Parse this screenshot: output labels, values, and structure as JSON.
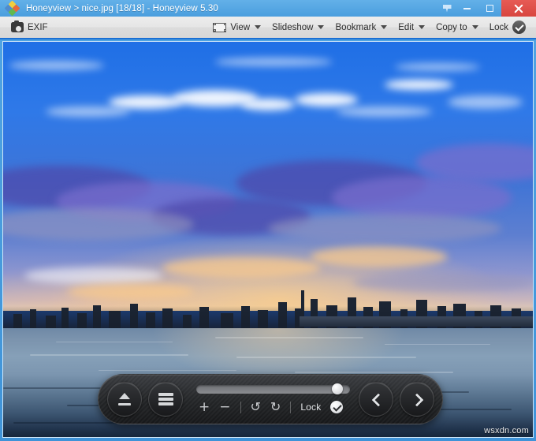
{
  "window": {
    "title": "Honeyview > nice.jpg [18/18] - Honeyview 5.30",
    "app_icon": "honeyview-diamond-icon",
    "controls": {
      "pin_label": "pin-icon",
      "minimize_label": "minimize-icon",
      "maximize_label": "maximize-icon",
      "close_label": "close-icon"
    },
    "accent_blue": "#1a6fd4",
    "titlebar_blue": "#4a9ede",
    "close_red": "#d8463f"
  },
  "toolbar": {
    "items": [
      {
        "label": "EXIF",
        "icon": "camera-icon",
        "has_caret": false
      },
      {
        "label": "View",
        "icon": "frame-icon",
        "has_caret": true
      },
      {
        "label": "Slideshow",
        "icon": "",
        "has_caret": true
      },
      {
        "label": "Bookmark",
        "icon": "",
        "has_caret": true
      },
      {
        "label": "Edit",
        "icon": "",
        "has_caret": true
      },
      {
        "label": "Copy to",
        "icon": "",
        "has_caret": true
      },
      {
        "label": "Lock",
        "icon": "check-badge-icon",
        "has_caret": false
      }
    ]
  },
  "image": {
    "description": "Seoul Han River city skyline at dusk under a vivid blue sky with scattered clouds",
    "filename": "nice.jpg",
    "index": "18/18"
  },
  "controlbar": {
    "eject_icon": "eject-icon",
    "menu_icon": "hamburger-menu-icon",
    "slider": {
      "value_percent": 88
    },
    "zoom_in": "+",
    "zoom_out": "−",
    "rotate_ccw": "↺",
    "rotate_cw": "↻",
    "lock_label": "Lock",
    "lock_checked": true,
    "prev_icon": "chevron-left-icon",
    "next_icon": "chevron-right-icon"
  },
  "watermark": {
    "text": "wsxdn.com"
  }
}
